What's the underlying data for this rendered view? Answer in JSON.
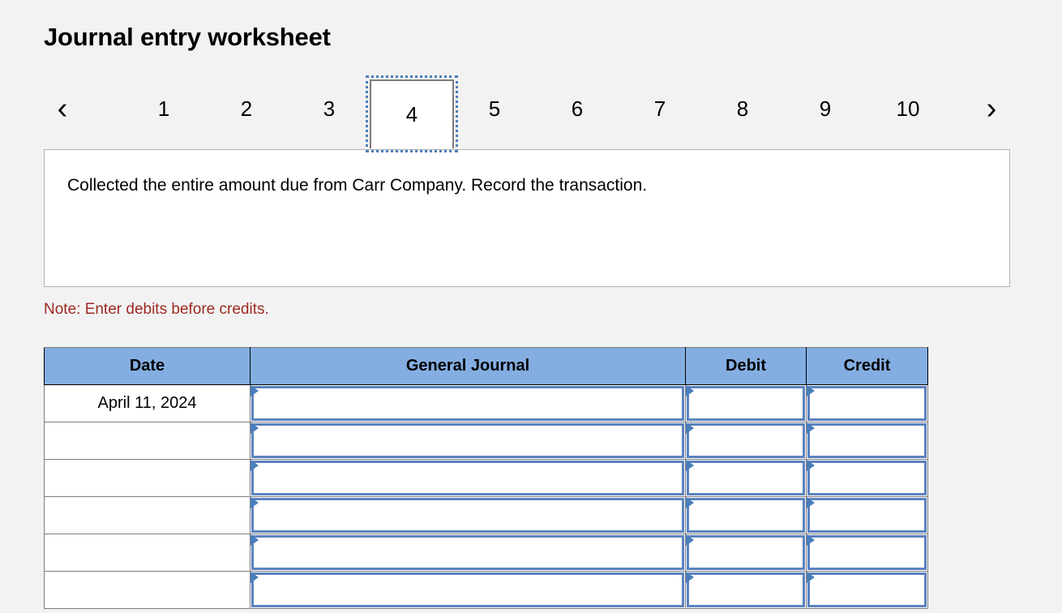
{
  "page_title": "Journal entry worksheet",
  "pager": {
    "prev_icon": "chevron-left-icon",
    "next_icon": "chevron-right-icon",
    "prev_glyph": "‹",
    "next_glyph": "›",
    "active_index": 3,
    "tabs": [
      "1",
      "2",
      "3",
      "4",
      "5",
      "6",
      "7",
      "8",
      "9",
      "10"
    ]
  },
  "instruction": {
    "text": "Collected the entire amount due from Carr Company. Record the transaction."
  },
  "note": {
    "text": "Note: Enter debits before credits.",
    "color": "#9c2b22"
  },
  "table": {
    "headers": [
      "Date",
      "General Journal",
      "Debit",
      "Credit"
    ],
    "header_bg": "#84AEE2",
    "input_border_color": "#5B83C0",
    "rows": [
      {
        "date": "April 11, 2024",
        "general_journal": "",
        "debit": "",
        "credit": ""
      },
      {
        "date": "",
        "general_journal": "",
        "debit": "",
        "credit": ""
      },
      {
        "date": "",
        "general_journal": "",
        "debit": "",
        "credit": ""
      },
      {
        "date": "",
        "general_journal": "",
        "debit": "",
        "credit": ""
      },
      {
        "date": "",
        "general_journal": "",
        "debit": "",
        "credit": ""
      },
      {
        "date": "",
        "general_journal": "",
        "debit": "",
        "credit": ""
      }
    ]
  }
}
